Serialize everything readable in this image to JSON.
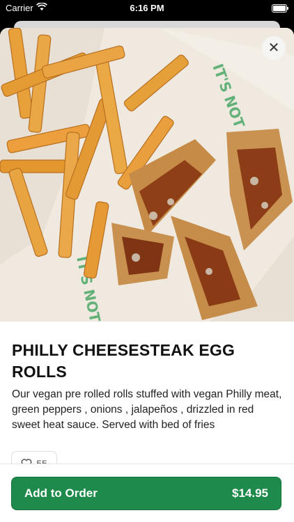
{
  "status_bar": {
    "carrier": "Carrier",
    "time": "6:16 PM"
  },
  "item": {
    "title": "PHILLY CHEESESTEAK EGG ROLLS",
    "description": "Our vegan pre rolled rolls stuffed with vegan Philly meat, green peppers , onions , jalapeños , drizzled in red sweet heat sauce. Served with bed of fries",
    "likes": "55",
    "image_alt": "Photo of egg rolls with red sauce and french fries on paper"
  },
  "actions": {
    "add_to_order_label": "Add to Order",
    "price": "$14.95"
  },
  "colors": {
    "primary_button": "#1e8a4c",
    "sheet_background": "#ffffff"
  }
}
